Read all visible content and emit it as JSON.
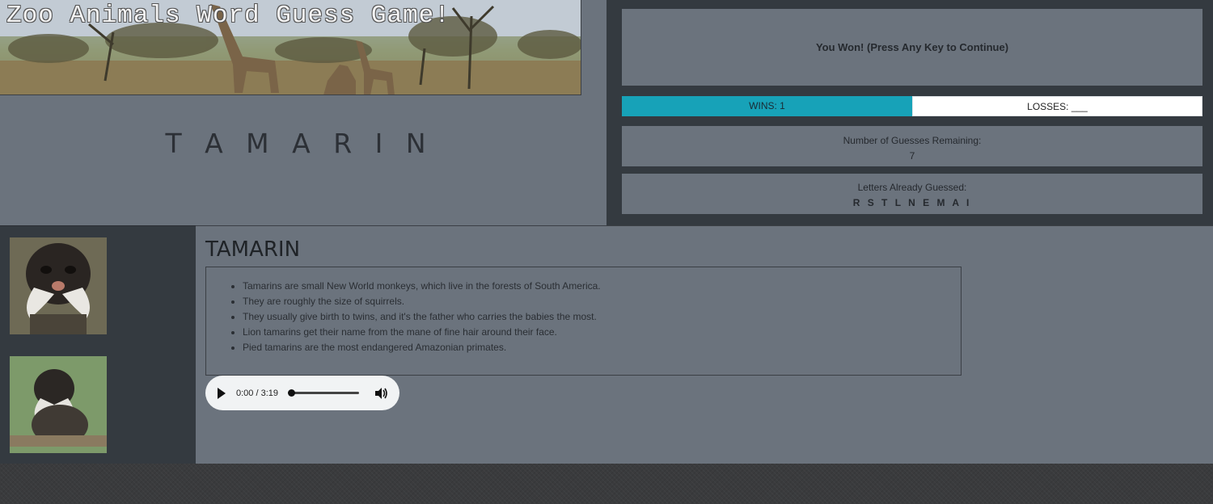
{
  "banner": {
    "title": "Zoo Animals Word Guess Game!"
  },
  "game": {
    "word": "T A M A R I N",
    "status": "You Won! (Press Any Key to Continue)",
    "wins": "WINS: 1",
    "losses": "LOSSES: ___",
    "guesses_label": "Number of Guesses Remaining:",
    "guesses_value": "7",
    "letters_label": "Letters Already Guessed:",
    "letters_value": "R S T L N E M A I"
  },
  "animal": {
    "heading": "TAMARIN",
    "facts": [
      "Tamarins are small New World monkeys, which live in the forests of South America.",
      "They are roughly the size of squirrels.",
      "They usually give birth to twins, and it's the father who carries the babies the most.",
      "Lion tamarins get their name from the mane of fine hair around their face.",
      "Pied tamarins are the most endangered Amazonian primates."
    ]
  },
  "audio": {
    "time": "0:00 / 3:19",
    "progress": 0
  },
  "icons": {
    "play": "play-icon",
    "volume": "volume-icon"
  },
  "colors": {
    "accent": "#17a2b8",
    "panel": "#6b737d",
    "dark": "#343a40"
  }
}
